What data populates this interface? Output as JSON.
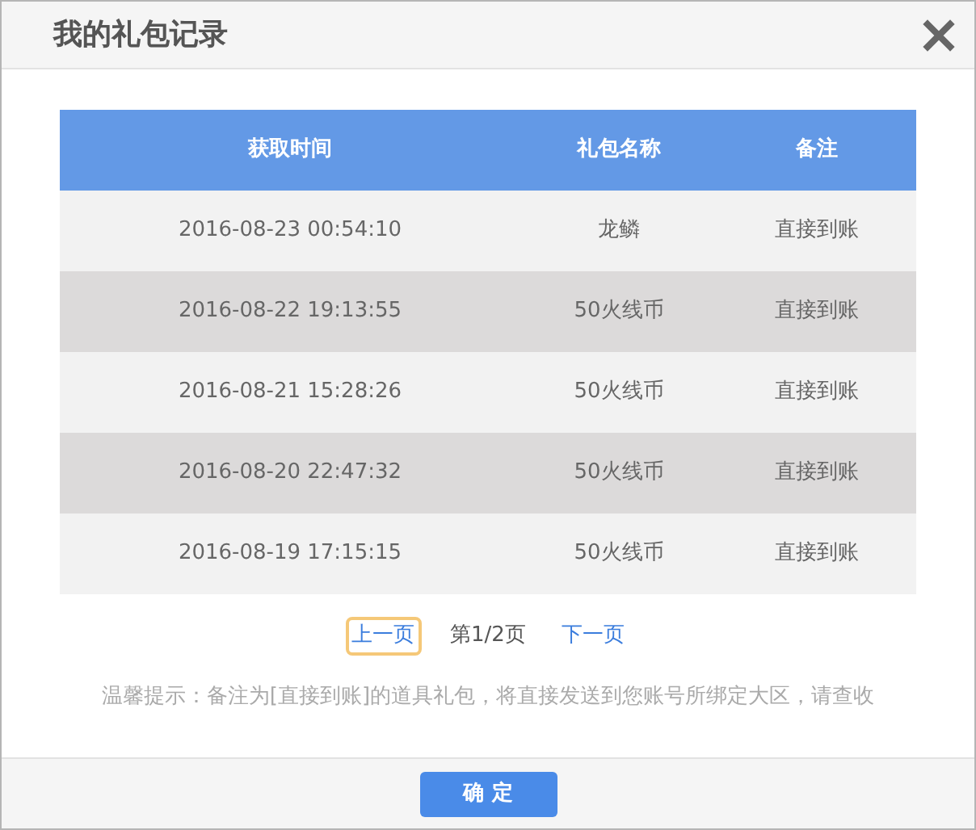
{
  "dialog": {
    "title": "我的礼包记录"
  },
  "table": {
    "columns": [
      "获取时间",
      "礼包名称",
      "备注"
    ],
    "rows": [
      [
        "2016-08-23 00:54:10",
        "龙鳞",
        "直接到账"
      ],
      [
        "2016-08-22 19:13:55",
        "50火线币",
        "直接到账"
      ],
      [
        "2016-08-21 15:28:26",
        "50火线币",
        "直接到账"
      ],
      [
        "2016-08-20 22:47:32",
        "50火线币",
        "直接到账"
      ],
      [
        "2016-08-19 17:15:15",
        "50火线币",
        "直接到账"
      ]
    ]
  },
  "pager": {
    "prev": {
      "label": "上一页",
      "focused": true
    },
    "page": "第1/2页",
    "next": {
      "label": "下一页",
      "focused": false
    }
  },
  "notice": "温馨提示：备注为[直接到账]的道具礼包，将直接发送到您账号所绑定大区，请查收",
  "buttons": [
    "确 定"
  ]
}
